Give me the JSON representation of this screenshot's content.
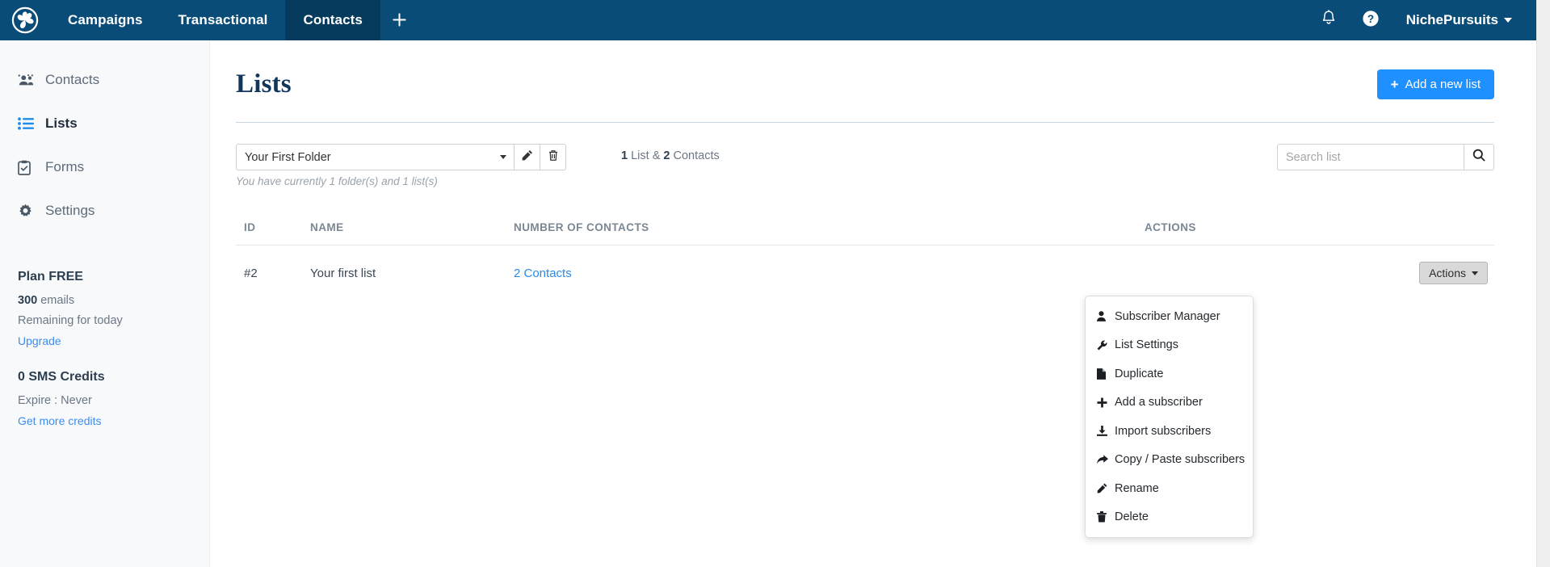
{
  "navbar": {
    "logo_icon": "pinwheel-logo-icon",
    "items": [
      {
        "label": "Campaigns",
        "active": false
      },
      {
        "label": "Transactional",
        "active": false
      },
      {
        "label": "Contacts",
        "active": true
      }
    ],
    "add_icon": "plus-icon",
    "bell_icon": "bell-icon",
    "help_icon": "question-circle-icon",
    "user_name": "NichePursuits",
    "user_caret_icon": "caret-down-icon",
    "background_color": "#0a4c78",
    "active_background_color": "#063b5e"
  },
  "sidebar": {
    "items": [
      {
        "label": "Contacts",
        "icon": "users-icon",
        "active": false
      },
      {
        "label": "Lists",
        "icon": "list-icon",
        "active": true
      },
      {
        "label": "Forms",
        "icon": "clipboard-check-icon",
        "active": false
      },
      {
        "label": "Settings",
        "icon": "gear-icon",
        "active": false
      }
    ],
    "plan": {
      "title": "Plan FREE",
      "amount": "300",
      "amount_suffix": " emails",
      "remaining": "Remaining for today",
      "link": "Upgrade"
    },
    "sms": {
      "title": "0 SMS Credits",
      "expire": "Expire : Never",
      "link": "Get more credits"
    },
    "background_color": "#f8f9fb",
    "active_icon_color": "#1f8ceb"
  },
  "main": {
    "page_title": "Lists",
    "add_button": {
      "label": "Add a new list",
      "icon": "plus-icon",
      "color": "#1f90ff"
    },
    "toolbar": {
      "folder_selected": "Your First Folder",
      "folder_caret_icon": "caret-down-icon",
      "edit_icon": "pencil-icon",
      "delete_icon": "trash-icon",
      "folder_note": "You have currently 1 folder(s) and 1 list(s)",
      "count_prefix": "1",
      "count_mid": " List & ",
      "count_num": "2",
      "count_suffix": " Contacts",
      "search_placeholder": "Search list",
      "search_value": "",
      "search_icon": "magnifier-icon"
    },
    "table": {
      "headers": [
        "ID",
        "NAME",
        "NUMBER OF CONTACTS",
        "ACTIONS"
      ],
      "rows": [
        {
          "id": "#2",
          "name": "Your first list",
          "contacts": "2 Contacts",
          "action_label": "Actions",
          "action_caret_icon": "caret-down-icon"
        }
      ]
    },
    "dropdown": {
      "items": [
        {
          "label": "Subscriber Manager",
          "icon": "user-icon"
        },
        {
          "label": "List Settings",
          "icon": "wrench-icon"
        },
        {
          "label": "Duplicate",
          "icon": "file-icon"
        },
        {
          "label": "Add a subscriber",
          "icon": "plus-icon"
        },
        {
          "label": "Import subscribers",
          "icon": "download-icon"
        },
        {
          "label": "Copy / Paste subscribers",
          "icon": "share-arrow-icon"
        },
        {
          "label": "Rename",
          "icon": "pencil-icon"
        },
        {
          "label": "Delete",
          "icon": "trash-icon"
        }
      ]
    }
  }
}
